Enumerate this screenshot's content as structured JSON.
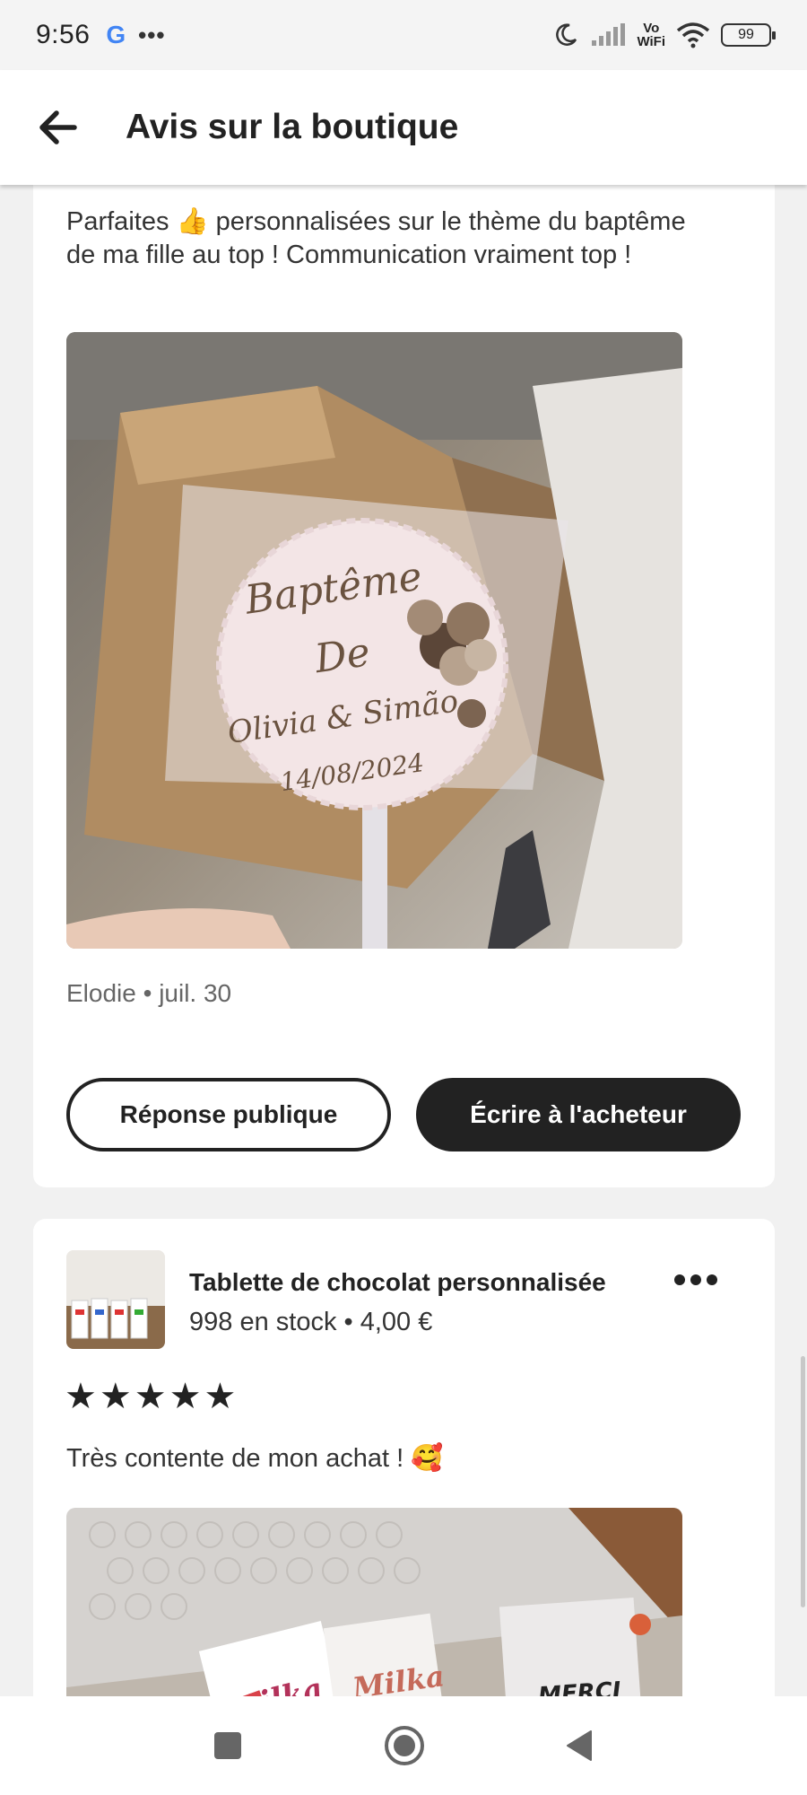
{
  "status_bar": {
    "time": "9:56",
    "google_letter": "G",
    "dots": "•••",
    "vowifi_top": "Vo",
    "vowifi_bottom": "WiFi",
    "battery": "99"
  },
  "header": {
    "title": "Avis sur la boutique",
    "back_icon": "arrow-left-icon"
  },
  "review1": {
    "text": "Parfaites 👍 personnalisées sur le thème du baptême de ma fille au top ! Communication vraiment top !",
    "reviewer": "Elodie • juil. 30",
    "photo": {
      "line1": "Baptême",
      "line2": "De",
      "line3": "Olivia & Simão",
      "line4": "14/08/2024"
    },
    "public_reply_label": "Réponse publique",
    "write_buyer_label": "Écrire à l'acheteur"
  },
  "review2": {
    "product_title": "Tablette de chocolat personnalisée",
    "product_meta": "998 en stock • 4,00 €",
    "more_icon": "more-horizontal-icon",
    "stars": "★★★★★",
    "rating": 5,
    "text": "Très contente de mon achat ! 🥰",
    "photo": {
      "brand": "Milka",
      "merci": "MERCI"
    }
  },
  "nav": {
    "recents_icon": "square-icon",
    "home_icon": "circle-icon",
    "back_icon": "triangle-back-icon"
  },
  "colors": {
    "primary_dark": "#222222",
    "background": "#f1f1f1",
    "card": "#ffffff"
  }
}
